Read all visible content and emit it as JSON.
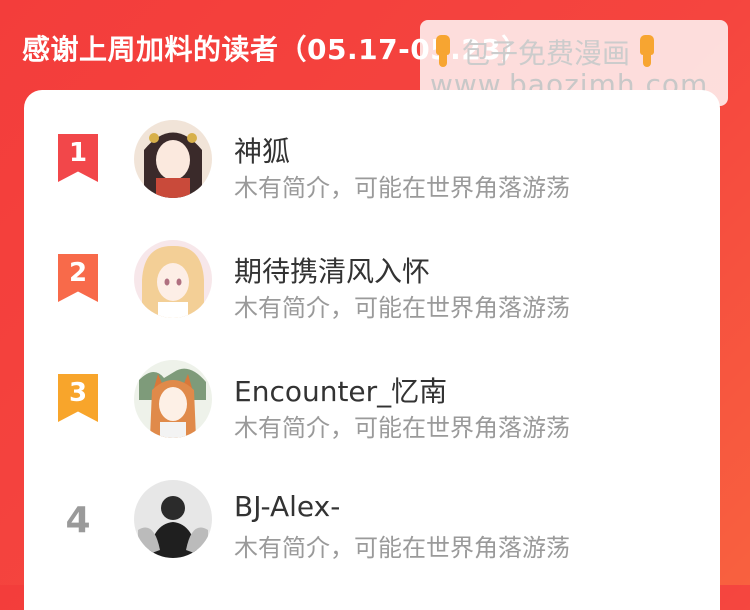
{
  "header": {
    "title": "感谢上周加料的读者（05.17-05.23）"
  },
  "watermark": {
    "line1": "包子免费漫画",
    "line2": "www.baozimh.com",
    "icon": "pointing-hand-icon"
  },
  "readers": [
    {
      "rank": "1",
      "name": "神狐",
      "desc": "木有简介，可能在世界角落游荡",
      "rank_color": "#f2474a",
      "avatar_bg": "#f1e4d8"
    },
    {
      "rank": "2",
      "name": "期待携清风入怀",
      "desc": "木有简介，可能在世界角落游荡",
      "rank_color": "#f86a4a",
      "avatar_bg": "#f7e7ea"
    },
    {
      "rank": "3",
      "name": "Encounter_忆南",
      "desc": "木有简介，可能在世界角落游荡",
      "rank_color": "#f8a52b",
      "avatar_bg": "#eef2ea"
    },
    {
      "rank": "4",
      "name": "BJ-Alex-",
      "desc": "木有简介，可能在世界角落游荡",
      "avatar_bg": "#e7e7e7"
    }
  ]
}
